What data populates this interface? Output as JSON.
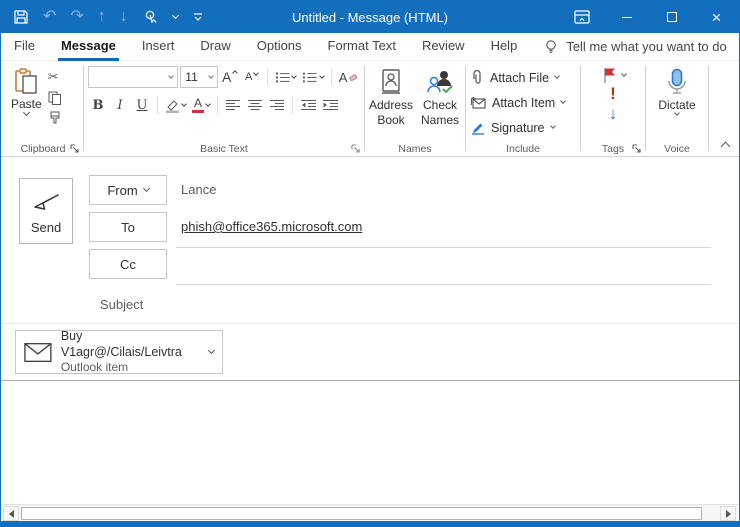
{
  "window": {
    "title": "Untitled - Message (HTML)"
  },
  "icons": {
    "undo": "↶",
    "redo": "↷",
    "move_up": "↑",
    "move_down": "↓",
    "scissors": "✂",
    "close": "×",
    "low_importance": "↓"
  },
  "tabs": {
    "items": [
      {
        "label": "File"
      },
      {
        "label": "Message"
      },
      {
        "label": "Insert"
      },
      {
        "label": "Draw"
      },
      {
        "label": "Options"
      },
      {
        "label": "Format Text"
      },
      {
        "label": "Review"
      },
      {
        "label": "Help"
      }
    ],
    "tell_me": "Tell me what you want to do"
  },
  "ribbon": {
    "clipboard": {
      "label": "Clipboard",
      "paste_label": "Paste"
    },
    "basic_text": {
      "label": "Basic Text",
      "font_name": "",
      "font_size": "11",
      "bold": "B",
      "italic": "I",
      "underline": "U",
      "grow_font": "A",
      "shrink_font": "A",
      "clear_format": "A",
      "font_color": "A"
    },
    "names": {
      "label": "Names",
      "address_book_label": "Address Book",
      "check_names_label": "Check Names"
    },
    "include": {
      "label": "Include",
      "attach_file_label": "Attach File",
      "attach_item_label": "Attach Item",
      "signature_label": "Signature"
    },
    "tags": {
      "label": "Tags",
      "high_importance": "!"
    },
    "voice": {
      "label": "Voice",
      "dictate_label": "Dictate"
    }
  },
  "compose": {
    "send_label": "Send",
    "fields": {
      "from_label": "From",
      "from_value": "Lance",
      "to_label": "To",
      "to_value": "phish@office365.microsoft.com",
      "cc_label": "Cc",
      "cc_value": "",
      "subject_label": "Subject",
      "subject_value": ""
    },
    "attachment": {
      "title": "Buy V1agr@/Cilais/Leivtra",
      "subtitle": "Outlook item"
    }
  },
  "colors": {
    "titlebar": "#146ebe",
    "accent": "#1467b8",
    "flag": "#d13438",
    "himp": "#c42b1c",
    "limp": "#2b7cd3"
  }
}
